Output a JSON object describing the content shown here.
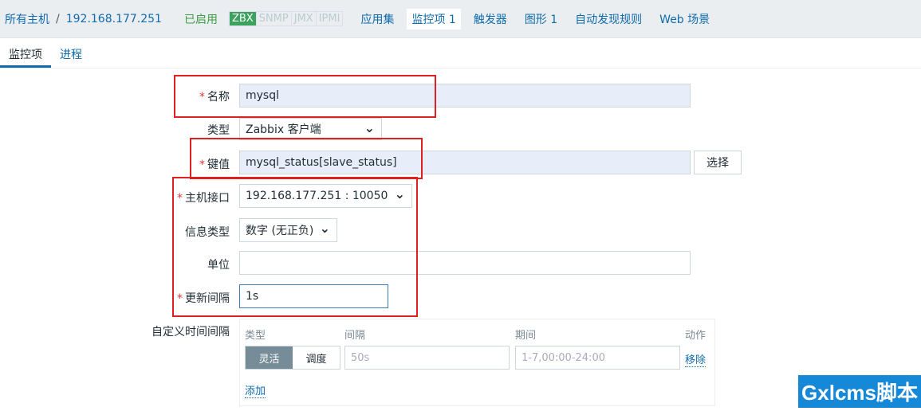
{
  "breadcrumb": {
    "all_hosts": "所有主机",
    "host": "192.168.177.251",
    "status": "已启用",
    "tags": [
      "ZBX",
      "SNMP",
      "JMX",
      "IPMI"
    ]
  },
  "nav": [
    "应用集",
    "监控项 1",
    "触发器",
    "图形 1",
    "自动发现规则",
    "Web 场景"
  ],
  "tabs": [
    "监控项",
    "进程"
  ],
  "form": {
    "name": {
      "label": "名称",
      "value": "mysql"
    },
    "type": {
      "label": "类型",
      "value": "Zabbix 客户端"
    },
    "key": {
      "label": "键值",
      "value": "mysql_status[slave_status]",
      "button": "选择"
    },
    "interface": {
      "label": "主机接口",
      "value": "192.168.177.251 : 10050"
    },
    "info_type": {
      "label": "信息类型",
      "value": "数字 (无正负)"
    },
    "units": {
      "label": "单位",
      "value": ""
    },
    "interval": {
      "label": "更新间隔",
      "value": "1s"
    },
    "custom": {
      "label": "自定义时间间隔",
      "headers": [
        "类型",
        "间隔",
        "期间",
        "动作"
      ],
      "flexible": "灵活",
      "scheduling": "调度",
      "interval_placeholder": "50s",
      "period_placeholder": "1-7,00:00-24:00",
      "remove": "移除",
      "add": "添加"
    }
  },
  "watermark": "Gxlcms脚本"
}
